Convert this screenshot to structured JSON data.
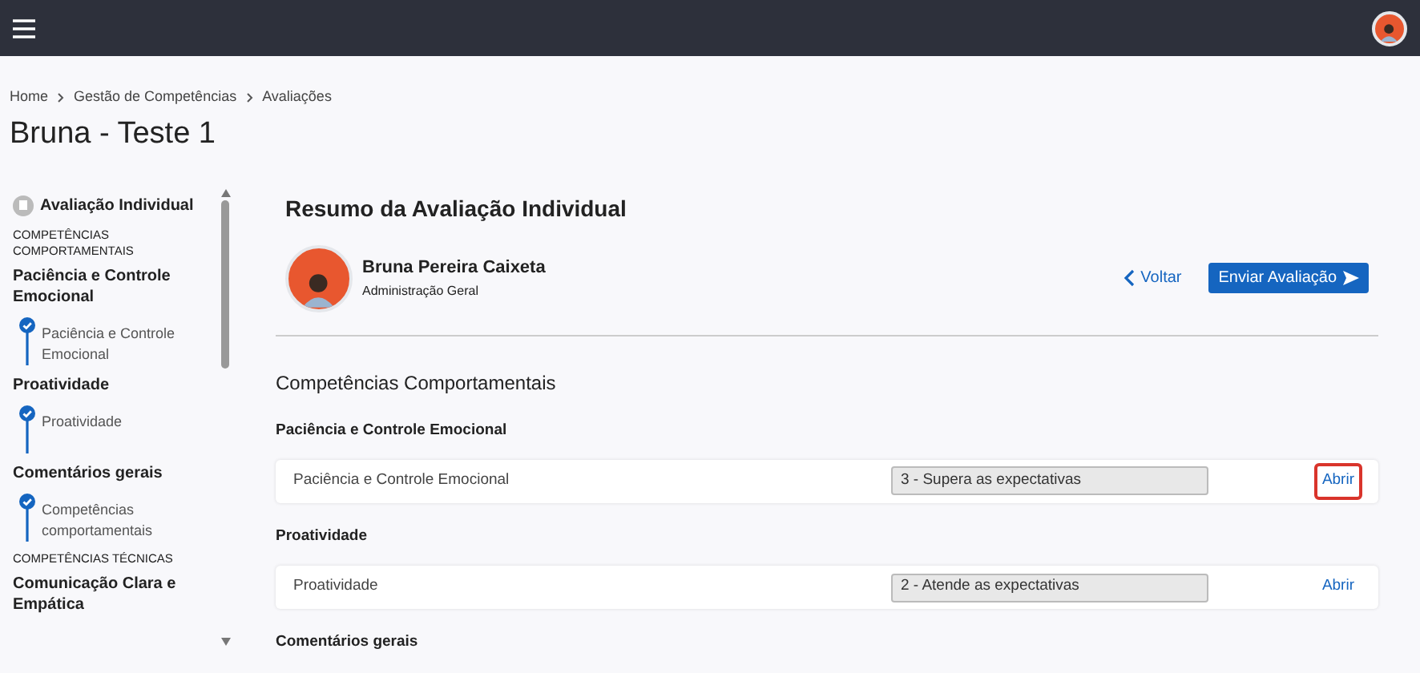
{
  "breadcrumb": [
    "Home",
    "Gestão de Competências",
    "Avaliações"
  ],
  "page_title": "Bruna - Teste 1",
  "sidebar": {
    "header": "Avaliação Individual",
    "items": [
      {
        "kind": "section",
        "label": "COMPETÊNCIAS COMPORTAMENTAIS"
      },
      {
        "kind": "group",
        "label": "Paciência e Controle Emocional"
      },
      {
        "kind": "step",
        "label": "Paciência e Controle Emocional",
        "checked": true
      },
      {
        "kind": "group",
        "label": "Proatividade"
      },
      {
        "kind": "step",
        "label": "Proatividade",
        "checked": true
      },
      {
        "kind": "group",
        "label": "Comentários gerais"
      },
      {
        "kind": "step",
        "label": "Competências comportamentais",
        "checked": true
      },
      {
        "kind": "section",
        "label": "COMPETÊNCIAS TÉCNICAS"
      },
      {
        "kind": "group",
        "label": "Comunicação Clara e Empática"
      }
    ]
  },
  "summary": {
    "title": "Resumo da Avaliação Individual",
    "person": {
      "name": "Bruna Pereira Caixeta",
      "department": "Administração Geral"
    },
    "back_label": "Voltar",
    "submit_label": "Enviar Avaliação"
  },
  "section_title": "Competências Comportamentais",
  "groups": [
    {
      "title": "Paciência e Controle Emocional",
      "rows": [
        {
          "name": "Paciência e Controle Emocional",
          "rating": "3 - Supera as expectativas",
          "action": "Abrir",
          "highlighted": true
        }
      ]
    },
    {
      "title": "Proatividade",
      "rows": [
        {
          "name": "Proatividade",
          "rating": "2 - Atende as expectativas",
          "action": "Abrir",
          "highlighted": false
        }
      ]
    }
  ],
  "next_group_title": "Comentários gerais"
}
